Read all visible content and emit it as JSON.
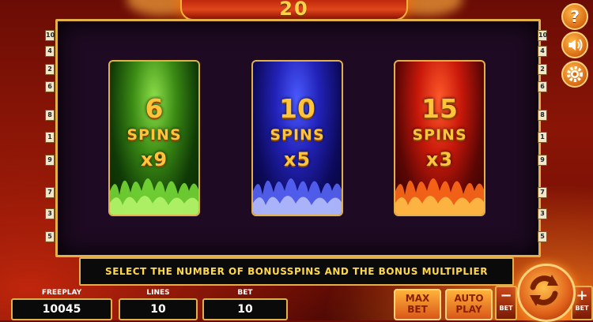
{
  "header": {
    "win_amount": "20"
  },
  "lines_left": [
    "10",
    "4",
    "2",
    "6",
    "8",
    "1",
    "9",
    "7",
    "3",
    "5"
  ],
  "lines_right": [
    "10",
    "4",
    "2",
    "6",
    "8",
    "1",
    "9",
    "7",
    "3",
    "5"
  ],
  "cards": [
    {
      "spins": "6",
      "spins_label": "SPINS",
      "multiplier": "x9",
      "color": "#3fa21a"
    },
    {
      "spins": "10",
      "spins_label": "SPINS",
      "multiplier": "x5",
      "color": "#2a2ad8"
    },
    {
      "spins": "15",
      "spins_label": "SPINS",
      "multiplier": "x3",
      "color": "#d8200e"
    }
  ],
  "message": "SELECT THE NUMBER OF BONUSSPINS AND THE BONUS MULTIPLIER",
  "freeplay": {
    "label": "FREEPLAY",
    "value": "10045"
  },
  "lines": {
    "label": "LINES",
    "value": "10"
  },
  "bet": {
    "label": "BET",
    "value": "10"
  },
  "buttons": {
    "max_bet_line1": "MAX",
    "max_bet_line2": "BET",
    "auto_play_line1": "AUTO",
    "auto_play_line2": "PLAY",
    "bet_minus_label": "BET",
    "bet_plus_label": "BET",
    "minus": "−",
    "plus": "+",
    "help": "?"
  },
  "icons": {
    "help": "help-icon",
    "sound": "speaker-icon",
    "settings": "gear-icon",
    "spin": "refresh-icon"
  },
  "colors": {
    "gold": "#e1b04a",
    "text_gold": "#ffc43a"
  }
}
